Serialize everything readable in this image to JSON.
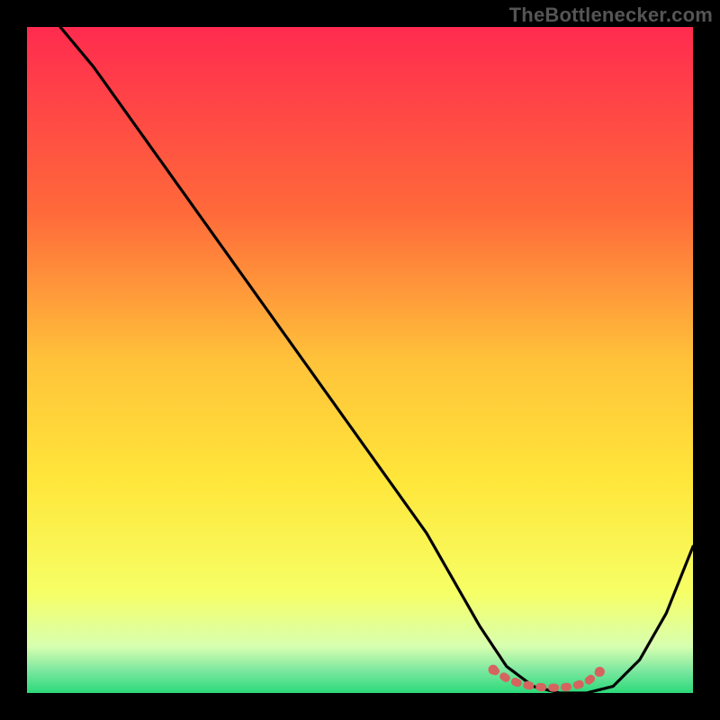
{
  "watermark": "TheBottlenecker.com",
  "colors": {
    "top": "#ff2b4f",
    "mid_upper": "#ff8a2a",
    "mid": "#ffe63a",
    "lower": "#f6ff66",
    "bottom_pale": "#d8ffb0",
    "bottom": "#2bd97a",
    "curve": "#000000",
    "dots": "#d5645f",
    "background": "#000000"
  },
  "chart_data": {
    "type": "line",
    "title": "",
    "xlabel": "",
    "ylabel": "",
    "xlim": [
      0,
      100
    ],
    "ylim": [
      0,
      100
    ],
    "series": [
      {
        "name": "bottleneck-curve",
        "x": [
          5,
          10,
          20,
          30,
          40,
          50,
          60,
          68,
          72,
          76,
          80,
          84,
          88,
          92,
          96,
          100
        ],
        "y": [
          100,
          94,
          80,
          66,
          52,
          38,
          24,
          10,
          4,
          1,
          0,
          0,
          1,
          5,
          12,
          22
        ]
      },
      {
        "name": "optimal-range-dots",
        "x": [
          70,
          72,
          74,
          76,
          78,
          80,
          82,
          84,
          86
        ],
        "y": [
          3.5,
          2.2,
          1.4,
          1.0,
          0.8,
          0.8,
          1.0,
          1.6,
          3.2
        ]
      }
    ],
    "gradient_stops": [
      {
        "offset": 0.0,
        "color": "#ff2b4f"
      },
      {
        "offset": 0.28,
        "color": "#ff6a3a"
      },
      {
        "offset": 0.5,
        "color": "#ffc23a"
      },
      {
        "offset": 0.68,
        "color": "#ffe63a"
      },
      {
        "offset": 0.85,
        "color": "#f6ff66"
      },
      {
        "offset": 0.93,
        "color": "#d8ffb0"
      },
      {
        "offset": 0.965,
        "color": "#7fe8a0"
      },
      {
        "offset": 1.0,
        "color": "#2bd97a"
      }
    ]
  }
}
